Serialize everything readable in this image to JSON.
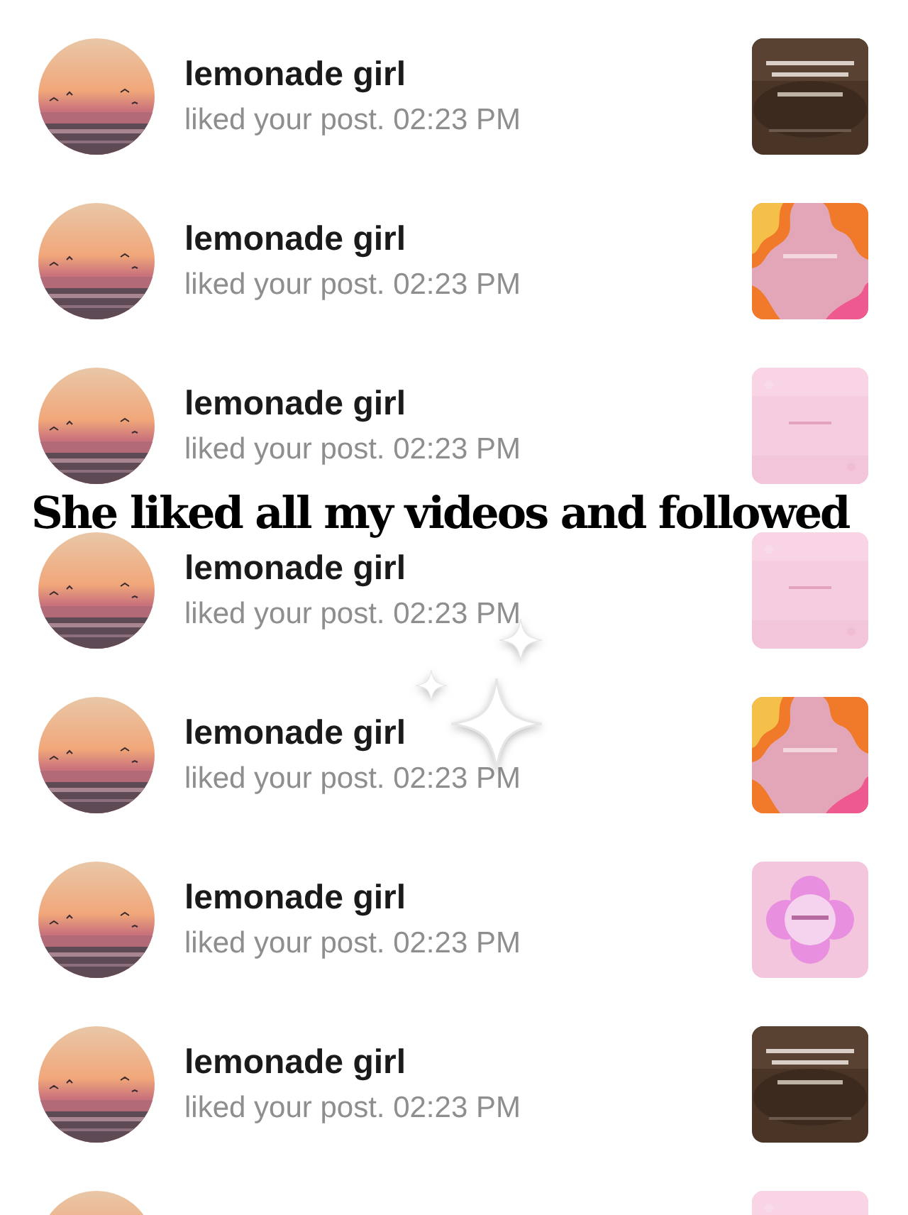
{
  "notifications": [
    {
      "avatar": {
        "kind": "picture"
      },
      "username": "lemonade girl",
      "activity": "liked your post. 02:23 PM",
      "thumbnail": {
        "kind": "picture"
      }
    },
    {
      "avatar": {
        "kind": "picture"
      },
      "username": "lemonade girl",
      "activity": "liked your post. 02:23 PM",
      "thumbnail": {
        "kind": "picture"
      }
    },
    {
      "avatar": {
        "kind": "picture"
      },
      "username": "lemonade girl",
      "activity": "liked your post. 02:23 PM",
      "thumbnail": {
        "kind": "picture"
      }
    },
    {
      "avatar": {
        "kind": "picture"
      },
      "username": "lemonade girl",
      "activity": "liked your post. 02:23 PM",
      "thumbnail": {
        "kind": "picture"
      }
    },
    {
      "avatar": {
        "kind": "picture"
      },
      "username": "lemonade girl",
      "activity": "liked your post. 02:23 PM",
      "thumbnail": {
        "kind": "picture"
      }
    },
    {
      "avatar": {
        "kind": "picture"
      },
      "username": "lemonade girl",
      "activity": "liked your post. 02:23 PM",
      "thumbnail": {
        "kind": "picture"
      }
    },
    {
      "avatar": {
        "kind": "picture"
      },
      "username": "lemonade girl",
      "activity": "liked your post. 02:23 PM",
      "thumbnail": {
        "kind": "picture"
      }
    },
    {
      "avatar": {
        "kind": "picture"
      },
      "thumbnail": {
        "kind": "picture"
      }
    }
  ],
  "caption": "She liked all my videos and followed"
}
